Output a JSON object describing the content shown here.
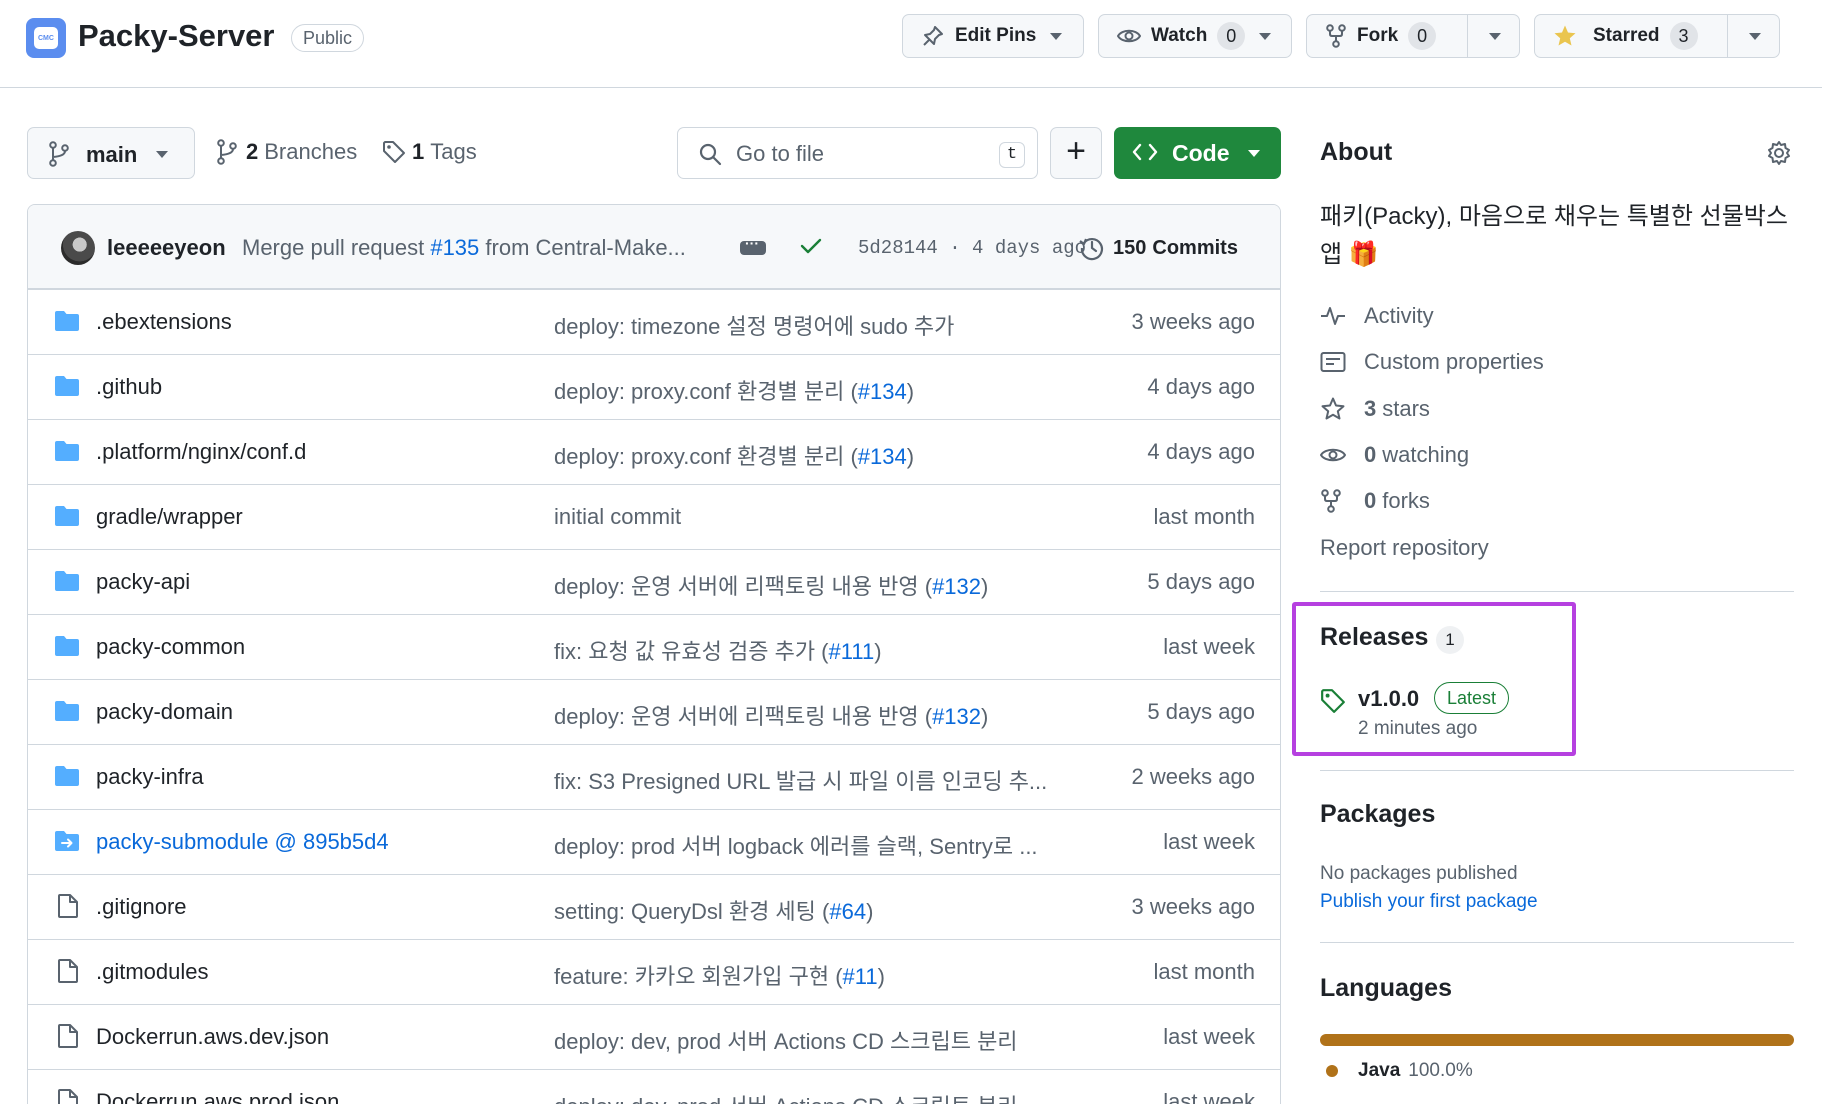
{
  "header": {
    "logo_text": "CMC",
    "repo_name": "Packy-Server",
    "visibility": "Public",
    "edit_pins_label": "Edit Pins",
    "watch_label": "Watch",
    "watch_count": "0",
    "fork_label": "Fork",
    "fork_count": "0",
    "starred_label": "Starred",
    "star_count": "3"
  },
  "toolbar": {
    "branch": "main",
    "branches_count": "2",
    "branches_label": "Branches",
    "tags_count": "1",
    "tags_label": "Tags",
    "search_placeholder": "Go to file",
    "search_shortcut": "t",
    "add_label": "+",
    "code_label": "Code"
  },
  "latest_commit": {
    "author": "leeeeeyeon",
    "message_prefix": "Merge pull request ",
    "pr_link": "#135",
    "message_suffix": " from Central-Make...",
    "sha_time": "5d28144 · 4 days ago",
    "commits_count": "150",
    "commits_label": "Commits"
  },
  "files": [
    {
      "type": "folder",
      "name": ".ebextensions",
      "msg": "deploy: timezone 설정 명령어에 sudo 추가",
      "pr": "",
      "msg_end": "",
      "time": "3 weeks ago"
    },
    {
      "type": "folder",
      "name": ".github",
      "msg": "deploy: proxy.conf 환경별 분리 (",
      "pr": "#134",
      "msg_end": ")",
      "time": "4 days ago"
    },
    {
      "type": "folder",
      "name": ".platform/nginx/conf.d",
      "msg": "deploy: proxy.conf 환경별 분리 (",
      "pr": "#134",
      "msg_end": ")",
      "time": "4 days ago"
    },
    {
      "type": "folder",
      "name": "gradle/wrapper",
      "msg": "initial commit",
      "pr": "",
      "msg_end": "",
      "time": "last month"
    },
    {
      "type": "folder",
      "name": "packy-api",
      "msg": "deploy: 운영 서버에 리팩토링 내용 반영 (",
      "pr": "#132",
      "msg_end": ")",
      "time": "5 days ago"
    },
    {
      "type": "folder",
      "name": "packy-common",
      "msg": "fix: 요청 값 유효성 검증 추가 (",
      "pr": "#111",
      "msg_end": ")",
      "time": "last week"
    },
    {
      "type": "folder",
      "name": "packy-domain",
      "msg": "deploy: 운영 서버에 리팩토링 내용 반영 (",
      "pr": "#132",
      "msg_end": ")",
      "time": "5 days ago"
    },
    {
      "type": "folder",
      "name": "packy-infra",
      "msg": "fix: S3 Presigned URL 발급 시 파일 이름 인코딩 추...",
      "pr": "",
      "msg_end": "",
      "time": "2 weeks ago"
    },
    {
      "type": "submodule",
      "name": "packy-submodule @ 895b5d4",
      "msg": "deploy: prod 서버 logback 에러를 슬랙, Sentry로 ...",
      "pr": "",
      "msg_end": "",
      "time": "last week"
    },
    {
      "type": "file",
      "name": ".gitignore",
      "msg": "setting: QueryDsl 환경 세팅 (",
      "pr": "#64",
      "msg_end": ")",
      "time": "3 weeks ago"
    },
    {
      "type": "file",
      "name": ".gitmodules",
      "msg": "feature: 카카오 회원가입 구현 (",
      "pr": "#11",
      "msg_end": ")",
      "time": "last month"
    },
    {
      "type": "file",
      "name": "Dockerrun.aws.dev.json",
      "msg": "deploy: dev, prod 서버 Actions CD 스크립트 분리",
      "pr": "",
      "msg_end": "",
      "time": "last week"
    },
    {
      "type": "file",
      "name": "Dockerrun.aws.prod.json",
      "msg": "deploy: dev, prod 서버 Actions CD 스크립트 분리",
      "pr": "",
      "msg_end": "",
      "time": "last week"
    }
  ],
  "about": {
    "title": "About",
    "description": "패키(Packy), 마음으로 채우는 특별한 선물박스 앱 🎁",
    "activity": "Activity",
    "custom_properties": "Custom properties",
    "stars_count": "3",
    "stars_label": "stars",
    "watching_count": "0",
    "watching_label": "watching",
    "forks_count": "0",
    "forks_label": "forks",
    "report": "Report repository"
  },
  "releases": {
    "title": "Releases",
    "count": "1",
    "version": "v1.0.0",
    "badge": "Latest",
    "time": "2 minutes ago",
    "highlight_color": "#b640e0"
  },
  "packages": {
    "title": "Packages",
    "empty": "No packages published",
    "link": "Publish your first package"
  },
  "languages": {
    "title": "Languages",
    "name": "Java",
    "percent": "100.0%",
    "color": "#b07219"
  }
}
